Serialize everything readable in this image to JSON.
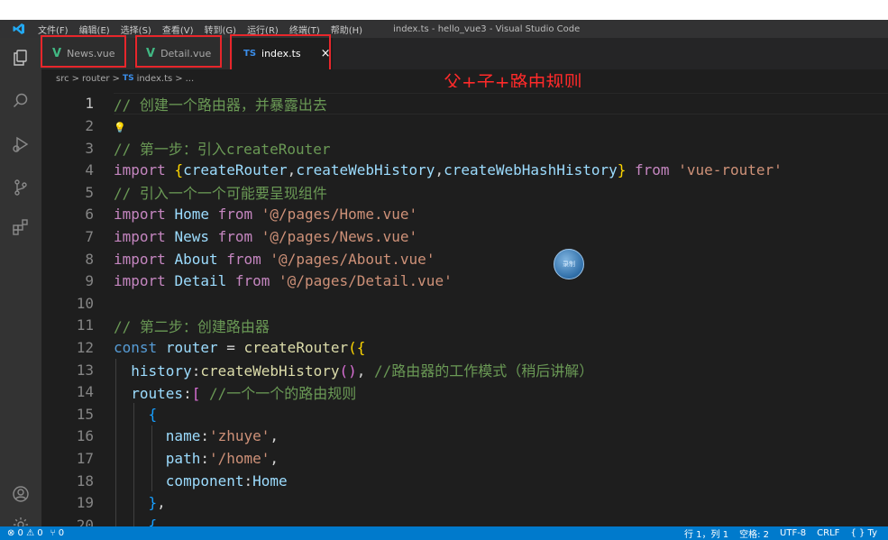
{
  "titlebar": {
    "menu": [
      "文件(F)",
      "编辑(E)",
      "选择(S)",
      "查看(V)",
      "转到(G)",
      "运行(R)",
      "终端(T)",
      "帮助(H)"
    ],
    "window_title": "index.ts - hello_vue3 - Visual Studio Code"
  },
  "tabs": [
    {
      "icon": "V",
      "label": "News.vue"
    },
    {
      "icon": "V",
      "label": "Detail.vue"
    },
    {
      "icon": "TS",
      "label": "index.ts",
      "close": "×"
    }
  ],
  "breadcrumb": {
    "parts": [
      "src",
      "router",
      "index.ts",
      "..."
    ],
    "ts_icon": "TS",
    "sep": ">"
  },
  "annotation": "父+子+路由规则",
  "cursor_badge": "录制",
  "editor": {
    "current_line": 1,
    "lines": [
      {
        "n": "1",
        "tokens": [
          [
            "c-comment",
            "// 创建一个路由器，并暴露出去"
          ]
        ]
      },
      {
        "n": "2",
        "bulb": true,
        "tokens": []
      },
      {
        "n": "3",
        "tokens": [
          [
            "c-comment",
            "// 第一步：引入createRouter"
          ]
        ]
      },
      {
        "n": "4",
        "tokens": [
          [
            "c-kw",
            "import"
          ],
          [
            "c-plain",
            " "
          ],
          [
            "c-br1",
            "{"
          ],
          [
            "c-var",
            "createRouter"
          ],
          [
            "c-plain",
            ","
          ],
          [
            "c-var",
            "createWebHistory"
          ],
          [
            "c-plain",
            ","
          ],
          [
            "c-var",
            "createWebHashHistory"
          ],
          [
            "c-br1",
            "}"
          ],
          [
            "c-plain",
            " "
          ],
          [
            "c-kw",
            "from"
          ],
          [
            "c-plain",
            " "
          ],
          [
            "c-str",
            "'vue-router'"
          ]
        ]
      },
      {
        "n": "5",
        "tokens": [
          [
            "c-comment",
            "// 引入一个一个可能要呈现组件"
          ]
        ]
      },
      {
        "n": "6",
        "tokens": [
          [
            "c-kw",
            "import"
          ],
          [
            "c-plain",
            " "
          ],
          [
            "c-var",
            "Home"
          ],
          [
            "c-plain",
            " "
          ],
          [
            "c-kw",
            "from"
          ],
          [
            "c-plain",
            " "
          ],
          [
            "c-str",
            "'@/pages/Home.vue'"
          ]
        ]
      },
      {
        "n": "7",
        "tokens": [
          [
            "c-kw",
            "import"
          ],
          [
            "c-plain",
            " "
          ],
          [
            "c-var",
            "News"
          ],
          [
            "c-plain",
            " "
          ],
          [
            "c-kw",
            "from"
          ],
          [
            "c-plain",
            " "
          ],
          [
            "c-str",
            "'@/pages/News.vue'"
          ]
        ]
      },
      {
        "n": "8",
        "tokens": [
          [
            "c-kw",
            "import"
          ],
          [
            "c-plain",
            " "
          ],
          [
            "c-var",
            "About"
          ],
          [
            "c-plain",
            " "
          ],
          [
            "c-kw",
            "from"
          ],
          [
            "c-plain",
            " "
          ],
          [
            "c-str",
            "'@/pages/About.vue'"
          ]
        ]
      },
      {
        "n": "9",
        "tokens": [
          [
            "c-kw",
            "import"
          ],
          [
            "c-plain",
            " "
          ],
          [
            "c-var",
            "Detail"
          ],
          [
            "c-plain",
            " "
          ],
          [
            "c-kw",
            "from"
          ],
          [
            "c-plain",
            " "
          ],
          [
            "c-str",
            "'@/pages/Detail.vue'"
          ]
        ]
      },
      {
        "n": "10",
        "tokens": []
      },
      {
        "n": "11",
        "tokens": [
          [
            "c-comment",
            "// 第二步：创建路由器"
          ]
        ]
      },
      {
        "n": "12",
        "tokens": [
          [
            "c-kw2",
            "const"
          ],
          [
            "c-plain",
            " "
          ],
          [
            "c-var",
            "router"
          ],
          [
            "c-plain",
            " = "
          ],
          [
            "c-fn",
            "createRouter"
          ],
          [
            "c-br1",
            "({"
          ]
        ]
      },
      {
        "n": "13",
        "tokens": [
          [
            "c-plain",
            "  "
          ],
          [
            "c-var",
            "history"
          ],
          [
            "c-plain",
            ":"
          ],
          [
            "c-fn",
            "createWebHistory"
          ],
          [
            "c-br2",
            "()"
          ],
          [
            "c-plain",
            ", "
          ],
          [
            "c-comment",
            "//路由器的工作模式（稍后讲解）"
          ]
        ]
      },
      {
        "n": "14",
        "tokens": [
          [
            "c-plain",
            "  "
          ],
          [
            "c-var",
            "routes"
          ],
          [
            "c-plain",
            ":"
          ],
          [
            "c-br2",
            "["
          ],
          [
            "c-plain",
            " "
          ],
          [
            "c-comment",
            "//一个一个的路由规则"
          ]
        ]
      },
      {
        "n": "15",
        "tokens": [
          [
            "c-plain",
            "    "
          ],
          [
            "c-br3",
            "{"
          ]
        ]
      },
      {
        "n": "16",
        "tokens": [
          [
            "c-plain",
            "      "
          ],
          [
            "c-var",
            "name"
          ],
          [
            "c-plain",
            ":"
          ],
          [
            "c-str",
            "'zhuye'"
          ],
          [
            "c-plain",
            ","
          ]
        ]
      },
      {
        "n": "17",
        "tokens": [
          [
            "c-plain",
            "      "
          ],
          [
            "c-var",
            "path"
          ],
          [
            "c-plain",
            ":"
          ],
          [
            "c-str",
            "'/home'"
          ],
          [
            "c-plain",
            ","
          ]
        ]
      },
      {
        "n": "18",
        "tokens": [
          [
            "c-plain",
            "      "
          ],
          [
            "c-var",
            "component"
          ],
          [
            "c-plain",
            ":"
          ],
          [
            "c-var",
            "Home"
          ]
        ]
      },
      {
        "n": "19",
        "tokens": [
          [
            "c-plain",
            "    "
          ],
          [
            "c-br3",
            "}"
          ],
          [
            "c-plain",
            ","
          ]
        ]
      },
      {
        "n": "20",
        "tokens": [
          [
            "c-plain",
            "    "
          ],
          [
            "c-br3",
            "{"
          ]
        ]
      }
    ]
  },
  "statusbar": {
    "left": [
      "⊗ 0  ⚠ 0",
      "⑂ 0"
    ],
    "right": [
      "行 1，列 1",
      "空格: 2",
      "UTF-8",
      "CRLF",
      "{ } Ty"
    ]
  },
  "colors": {
    "accent": "#007acc",
    "highlight_box": "#e8262b",
    "annotation": "#ff2a2a"
  }
}
